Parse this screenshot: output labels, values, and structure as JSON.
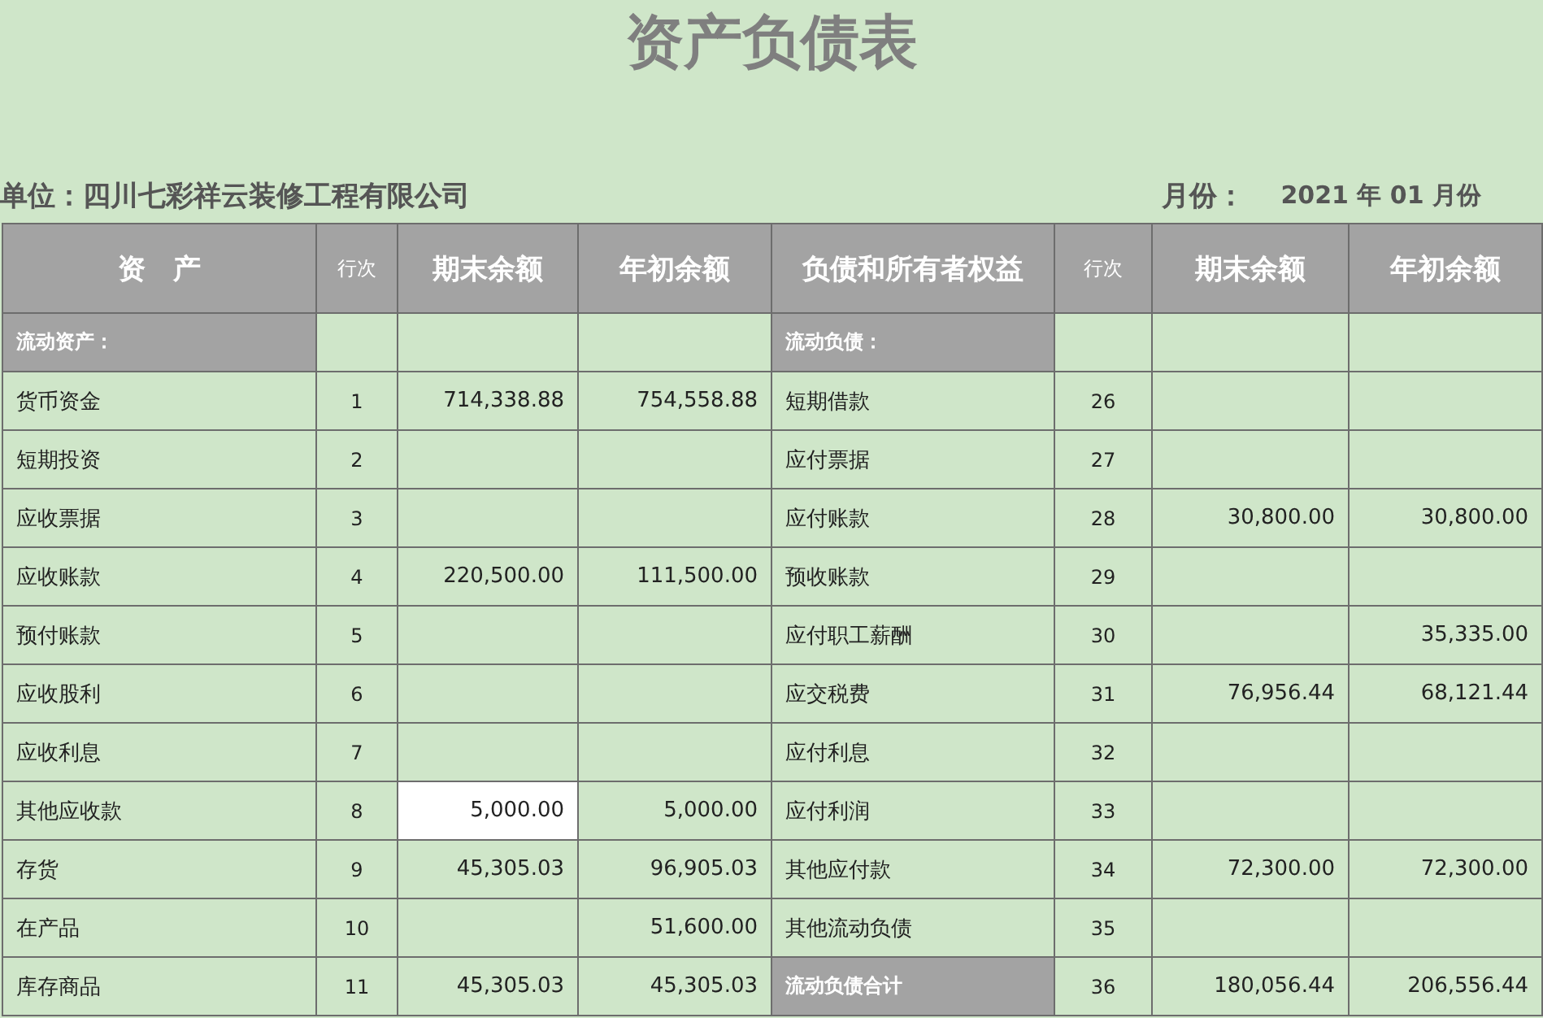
{
  "title": "资产负债表",
  "unit": "单位：四川七彩祥云装修工程有限公司",
  "month_label": "月份：",
  "month_value": "2021 年 01 月份",
  "columns": [
    "资　产",
    "行次",
    "期末余额",
    "年初余额",
    "负债和所有者权益",
    "行次",
    "期末余额",
    "年初余额"
  ],
  "rows": [
    {
      "left": {
        "item": "流动资产：",
        "kind": "heading",
        "end_selected": false
      },
      "right": {
        "item": "流动负债：",
        "kind": "heading",
        "end_selected": false
      }
    },
    {
      "left": {
        "item": "货币资金",
        "kind": "item",
        "line": "1",
        "end": "714,338.88",
        "begin": "754,558.88",
        "end_selected": false
      },
      "right": {
        "item": "短期借款",
        "kind": "item",
        "line": "26",
        "end_selected": false
      }
    },
    {
      "left": {
        "item": "短期投资",
        "kind": "item",
        "line": "2",
        "end_selected": false
      },
      "right": {
        "item": "应付票据",
        "kind": "item",
        "line": "27",
        "end_selected": false
      }
    },
    {
      "left": {
        "item": "应收票据",
        "kind": "item",
        "line": "3",
        "end_selected": false
      },
      "right": {
        "item": "应付账款",
        "kind": "item",
        "line": "28",
        "end": "30,800.00",
        "begin": "30,800.00",
        "end_selected": false
      }
    },
    {
      "left": {
        "item": "应收账款",
        "kind": "item",
        "line": "4",
        "end": "220,500.00",
        "begin": "111,500.00",
        "end_selected": false
      },
      "right": {
        "item": "预收账款",
        "kind": "item",
        "line": "29",
        "end_selected": false
      }
    },
    {
      "left": {
        "item": "预付账款",
        "kind": "item",
        "line": "5",
        "end_selected": false
      },
      "right": {
        "item": "应付职工薪酬",
        "kind": "item",
        "line": "30",
        "begin": "35,335.00",
        "end_selected": false
      }
    },
    {
      "left": {
        "item": "应收股利",
        "kind": "item",
        "line": "6",
        "end_selected": false
      },
      "right": {
        "item": "应交税费",
        "kind": "item",
        "line": "31",
        "end": "76,956.44",
        "begin": "68,121.44",
        "end_selected": false
      }
    },
    {
      "left": {
        "item": "应收利息",
        "kind": "item",
        "line": "7",
        "end_selected": false
      },
      "right": {
        "item": "应付利息",
        "kind": "item",
        "line": "32",
        "end_selected": false
      }
    },
    {
      "left": {
        "item": "其他应收款",
        "kind": "item",
        "line": "8",
        "end": "5,000.00",
        "begin": "5,000.00",
        "end_selected": true
      },
      "right": {
        "item": "应付利润",
        "kind": "item",
        "line": "33",
        "end_selected": false
      }
    },
    {
      "left": {
        "item": "存货",
        "kind": "item",
        "line": "9",
        "end": "45,305.03",
        "begin": "96,905.03",
        "end_selected": false
      },
      "right": {
        "item": "其他应付款",
        "kind": "item",
        "line": "34",
        "end": "72,300.00",
        "begin": "72,300.00",
        "end_selected": false
      }
    },
    {
      "left": {
        "item": "在产品",
        "kind": "item",
        "line": "10",
        "begin": "51,600.00",
        "end_selected": false
      },
      "right": {
        "item": "其他流动负债",
        "kind": "item",
        "line": "35",
        "end_selected": false
      }
    },
    {
      "left": {
        "item": "库存商品",
        "kind": "item",
        "line": "11",
        "end": "45,305.03",
        "begin": "45,305.03",
        "end_selected": false
      },
      "right": {
        "item": "流动负债合计",
        "kind": "heading",
        "line": "36",
        "end": "180,056.44",
        "begin": "206,556.44",
        "end_selected": false
      }
    }
  ]
}
